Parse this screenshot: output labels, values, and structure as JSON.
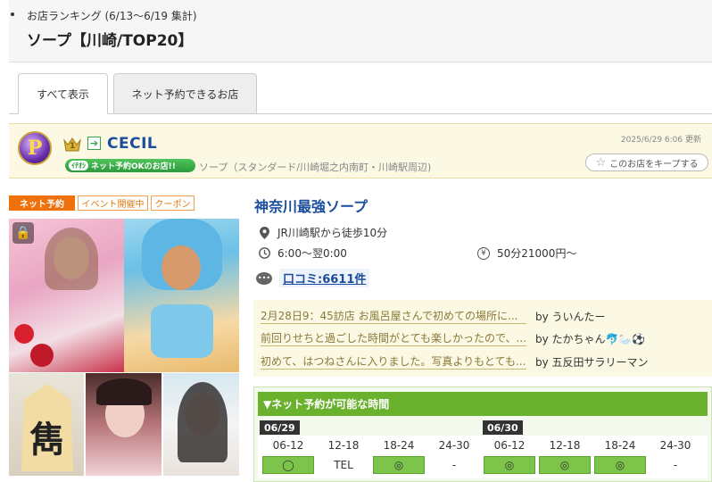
{
  "header": {
    "subtitle": "お店ランキング (6/13〜6/19 集計)",
    "title": "ソープ【川崎/TOP20】"
  },
  "tabs": [
    {
      "label": "すべて表示",
      "active": true
    },
    {
      "label": "ネット予約できるお店",
      "active": false
    }
  ],
  "shop": {
    "logo_letter": "P",
    "rank": "1",
    "name": "CECIL",
    "net_badge": "ネット予約OKのお店!!",
    "net_badge_pill": "ｲﾁｵｼ",
    "genre": "ソープ（スタンダード/川崎堀之内南町・川崎駅周辺)",
    "updated": "2025/6/29 6:06 更新",
    "keep_label": "このお店をキープする",
    "tags": {
      "net": "ネット予約",
      "event": "イベント開催中",
      "coupon": "クーポン"
    },
    "catch": "神奈川最強ソープ",
    "access": "JR川崎駅から徒歩10分",
    "hours": "6:00〜翌0:00",
    "price": "50分21000円〜",
    "kuchikomi": "口コミ:6611件",
    "thumb1_char": "雋"
  },
  "reviews": [
    {
      "text": "2月28日9：45訪店 お風呂屋さんで初めての場所に...",
      "by": "by ういんたー"
    },
    {
      "text": "前回りせちと過ごした時間がとても楽しかったので、...",
      "by": "by たかちゃん🐬🦢⚽"
    },
    {
      "text": "初めて、はつねさんに入りました。写真よりもとても...",
      "by": "by 五反田サラリーマン"
    }
  ],
  "booking": {
    "title": "▼ネット予約が可能な時間",
    "dates": [
      "06/29",
      "06/30"
    ],
    "slot_labels": [
      "06-12",
      "12-18",
      "18-24",
      "24-30",
      "06-12",
      "12-18",
      "18-24",
      "24-30"
    ],
    "slot_values": [
      "◯",
      "TEL",
      "◎",
      "-",
      "◎",
      "◎",
      "◎",
      "-"
    ],
    "slot_available": [
      true,
      false,
      true,
      false,
      true,
      true,
      true,
      false
    ]
  },
  "colors": {
    "accent_blue": "#1a4d9c",
    "net_orange": "#f0700a",
    "booking_green": "#6ab12e"
  }
}
